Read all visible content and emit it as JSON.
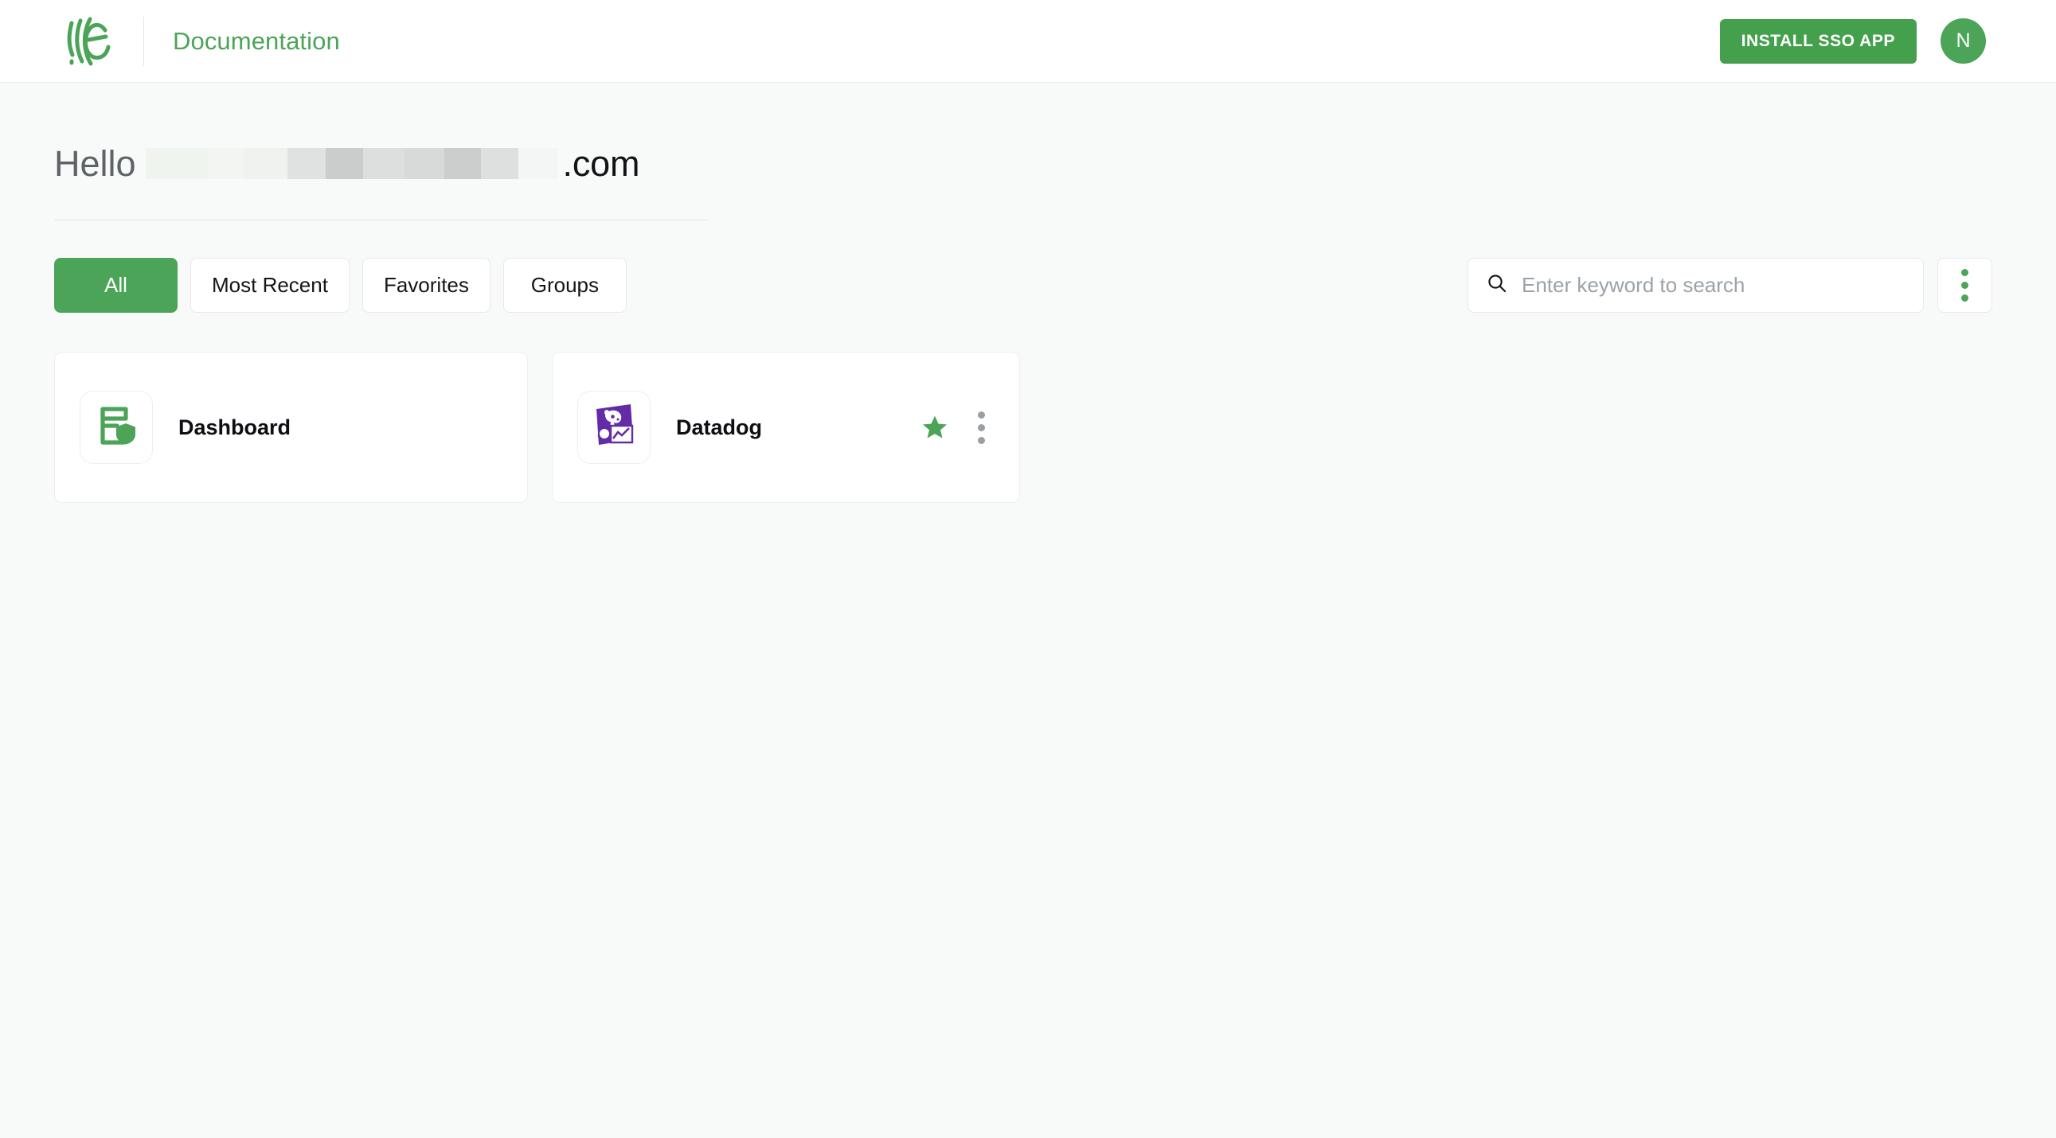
{
  "header": {
    "logo_icon": "edgewise-arcs-logo-icon",
    "app_title": "Documentation",
    "install_button": "INSTALL SSO APP",
    "avatar_initial": "N"
  },
  "greeting": {
    "hello_text": "Hello",
    "redacted_placeholder": "",
    "domain_suffix": ".com",
    "redaction_segments": [
      {
        "width": 78,
        "color": "#eff4ef"
      },
      {
        "width": 45,
        "color": "#f3f5f3"
      },
      {
        "width": 55,
        "color": "#f0f2f0"
      },
      {
        "width": 48,
        "color": "#e0e1e1"
      },
      {
        "width": 47,
        "color": "#cbcccc"
      },
      {
        "width": 52,
        "color": "#dddede"
      },
      {
        "width": 50,
        "color": "#d8d9d9"
      },
      {
        "width": 46,
        "color": "#cccdcd"
      },
      {
        "width": 47,
        "color": "#dedfdf"
      },
      {
        "width": 50,
        "color": "#f4f5f5"
      }
    ]
  },
  "tabs": [
    {
      "label": "All",
      "active": true
    },
    {
      "label": "Most Recent",
      "active": false
    },
    {
      "label": "Favorites",
      "active": false
    },
    {
      "label": "Groups",
      "active": false
    }
  ],
  "search": {
    "icon": "search-icon",
    "value": "",
    "placeholder": "Enter keyword to search"
  },
  "overflow_menu": {
    "icon": "kebab-menu-icon",
    "dot_color": "#4ba457"
  },
  "apps": [
    {
      "name": "Dashboard",
      "icon": "dashboard-shield-icon",
      "favorited": false,
      "has_menu": false
    },
    {
      "name": "Datadog",
      "icon": "datadog-logo-icon",
      "favorited": true,
      "has_menu": true
    }
  ],
  "colors": {
    "brand_green": "#4ba457",
    "button_green": "#45a04e",
    "datadog_purple": "#632ca6",
    "page_background": "#f8f9f9",
    "card_background": "#ffffff",
    "border": "#e7e9ea",
    "kebab_gray": "#9a9fa3"
  }
}
